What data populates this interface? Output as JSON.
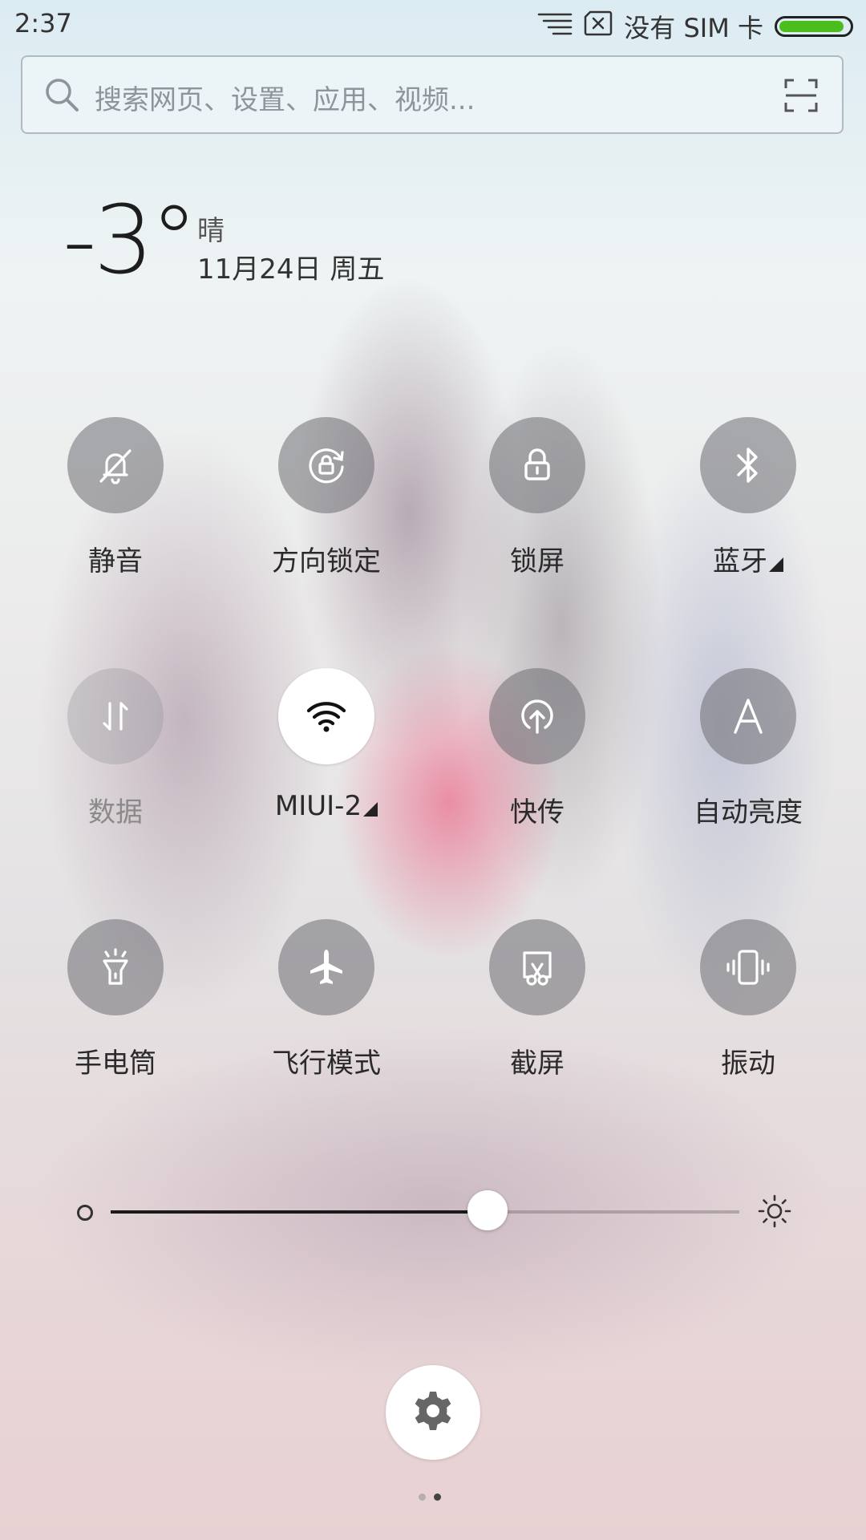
{
  "status_bar": {
    "time": "2:37",
    "sim_text": "没有 SIM 卡",
    "battery_level": 1.0,
    "battery_color": "#4bbe1e"
  },
  "search": {
    "placeholder": "搜索网页、设置、应用、视频..."
  },
  "weather": {
    "temperature": "-3°",
    "condition": "晴",
    "date": "11月24日 周五"
  },
  "toggles": [
    {
      "label": "静音",
      "icon": "bell-off-icon",
      "state": "off"
    },
    {
      "label": "方向锁定",
      "icon": "rotation-lock-icon",
      "state": "off"
    },
    {
      "label": "锁屏",
      "icon": "lock-icon",
      "state": "off"
    },
    {
      "label": "蓝牙",
      "icon": "bluetooth-icon",
      "state": "off",
      "has_more": true
    },
    {
      "label": "数据",
      "icon": "mobile-data-icon",
      "state": "disabled"
    },
    {
      "label": "MIUI-2",
      "icon": "wifi-icon",
      "state": "on",
      "has_more": true
    },
    {
      "label": "快传",
      "icon": "share-upload-icon",
      "state": "off"
    },
    {
      "label": "自动亮度",
      "icon": "auto-brightness-icon",
      "state": "off"
    },
    {
      "label": "手电筒",
      "icon": "flashlight-icon",
      "state": "off"
    },
    {
      "label": "飞行模式",
      "icon": "airplane-icon",
      "state": "off"
    },
    {
      "label": "截屏",
      "icon": "screenshot-icon",
      "state": "off"
    },
    {
      "label": "振动",
      "icon": "vibrate-icon",
      "state": "off"
    }
  ],
  "brightness": {
    "level": 0.6,
    "low_icon": "brightness-low-icon",
    "high_icon": "brightness-high-icon"
  },
  "settings": {
    "icon": "gear-icon"
  },
  "pager": {
    "pages": 2,
    "current": 2
  },
  "colors": {
    "toggle_off_bg": "rgba(110,110,115,0.55)",
    "toggle_on_bg": "#ffffff"
  }
}
